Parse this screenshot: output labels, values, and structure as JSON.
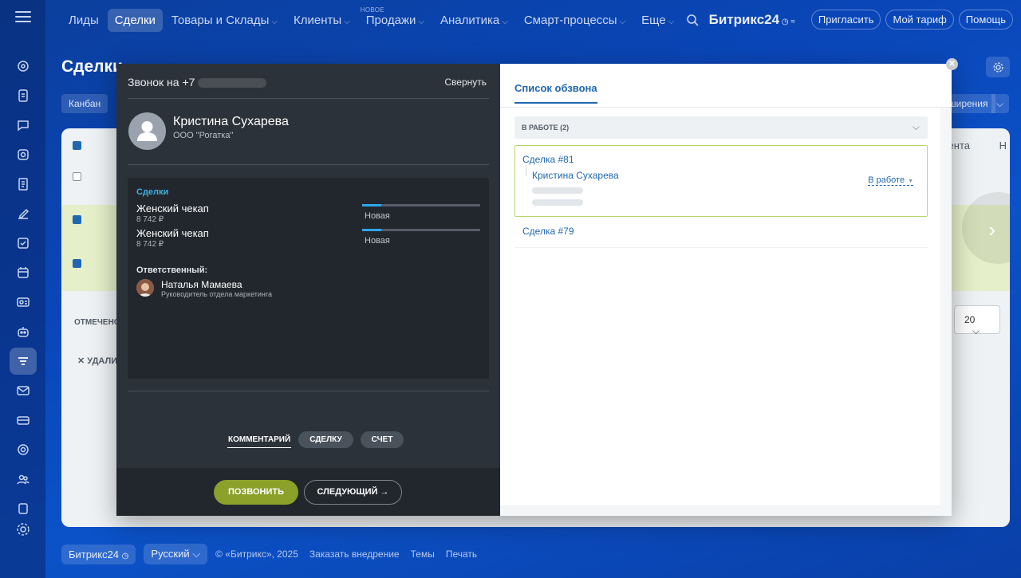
{
  "topnav": {
    "items": [
      {
        "label": "Лиды",
        "active": false,
        "dropdown": false
      },
      {
        "label": "Сделки",
        "active": true,
        "dropdown": false
      },
      {
        "label": "Товары и Склады",
        "active": false,
        "dropdown": true
      },
      {
        "label": "Клиенты",
        "active": false,
        "dropdown": true
      },
      {
        "label": "Продажи",
        "active": false,
        "dropdown": true,
        "badge": "НОВОЕ"
      },
      {
        "label": "Аналитика",
        "active": false,
        "dropdown": true
      },
      {
        "label": "Смарт-процессы",
        "active": false,
        "dropdown": true
      },
      {
        "label": "Еще",
        "active": false,
        "dropdown": true
      }
    ],
    "logo": "Битрикс24",
    "invite": "Пригласить",
    "tariff": "Мой тариф",
    "help": "Помощь"
  },
  "page": {
    "title": "Сделки",
    "kanban_tab": "Канбан",
    "extensions_label": "ширения",
    "col_right": "ента",
    "col_right2": "Н",
    "marked": "ОТМЕЧЕНО:",
    "delete": "УДАЛИ",
    "page_size": "20"
  },
  "footer": {
    "brand": "Битрикс24",
    "language": "Русский",
    "copyright": "© «Битрикс», 2025",
    "links": [
      "Заказать внедрение",
      "Темы",
      "Печать"
    ]
  },
  "call": {
    "header": "Звонок на +7",
    "collapse": "Свернуть",
    "contact_name": "Кристина Сухарева",
    "contact_company": "ООО \"Рогатка\"",
    "deals_title": "Сделки",
    "deals": [
      {
        "name": "Женский чекап",
        "price": "8 742 ₽",
        "status": "Новая"
      },
      {
        "name": "Женский чекап",
        "price": "8 742 ₽",
        "status": "Новая"
      }
    ],
    "responsible_title": "Ответственный:",
    "responsible_name": "Наталья Мамаева",
    "responsible_role": "Руководитель отдела маркетинга",
    "tabs": [
      "КОММЕНТАРИЙ",
      "СДЕЛКУ",
      "СЧЕТ"
    ],
    "btn_call": "ПОЗВОНИТЬ",
    "btn_next": "СЛЕДУЮЩИЙ",
    "colors": {
      "accent_green": "#8ba12a",
      "deal_link": "#3fb1e2",
      "dark_bg": "#2c3239"
    }
  },
  "calllist": {
    "tab": "Список обзвона",
    "group": "В РАБОТЕ (2)",
    "items": [
      {
        "title": "Сделка #81",
        "contact": "Кристина Сухарева",
        "status": "В работе"
      },
      {
        "title": "Сделка #79"
      }
    ]
  }
}
